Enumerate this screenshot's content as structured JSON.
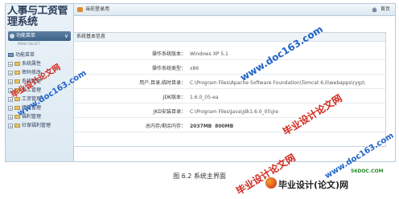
{
  "app": {
    "title": "人事与工资管理系统"
  },
  "sidebar": {
    "menu_label": "功能菜单",
    "collapse_icon": "chevron-down-icon",
    "sub_label": "MENU SELECT",
    "tree": [
      {
        "label": "功能菜单",
        "root": true
      },
      {
        "label": "系统属性"
      },
      {
        "label": "密码修改"
      },
      {
        "label": "系统管理"
      },
      {
        "label": "员工管理"
      },
      {
        "label": "工资管理"
      },
      {
        "label": "绩效管理"
      },
      {
        "label": "福利管理"
      },
      {
        "label": "社保福利管理"
      }
    ]
  },
  "topbar": {
    "location": "当前登录用",
    "home": "首页"
  },
  "panel": {
    "title": "系统基本信息",
    "rows": [
      {
        "key": "操作系统版本：",
        "value": "Windows XP 5.1"
      },
      {
        "key": "操作系统类型：",
        "value": "x86"
      },
      {
        "key": "用户,目录,临时目录：",
        "value": "C:\\Program Files\\Apache Software Foundation\\Tomcat 6.0\\webapps\\rygz\\"
      },
      {
        "key": "JDK版本：",
        "value": "1.6.0_05-ea"
      },
      {
        "key": "JKD安装目录：",
        "value": "C:\\Program Files\\Java\\jdk1.6.0_05\\jre"
      }
    ],
    "memory": {
      "key": "总内存/剩余内存：",
      "used": "2037MB",
      "free": "800MB"
    }
  },
  "watermarks": [
    "毕业设计论文网",
    "www.doc163.com",
    "www.doc163.com",
    "毕业设计论文网",
    "毕业设计论文网",
    "www.doc163.com"
  ],
  "caption": "图 6.2  系统主界面",
  "footer": {
    "logo": "毕业设计(论文)网",
    "site": "56DOC.COM"
  }
}
